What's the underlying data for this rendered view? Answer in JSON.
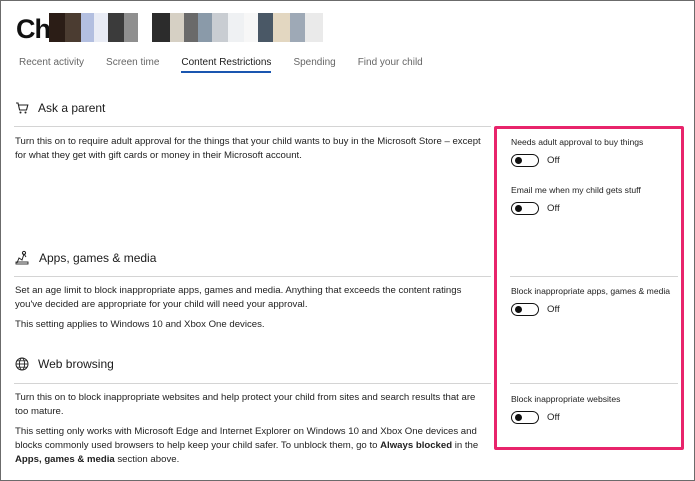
{
  "header": {
    "title": "Ch"
  },
  "tabs": [
    {
      "label": "Recent activity"
    },
    {
      "label": "Screen time"
    },
    {
      "label": "Content Restrictions"
    },
    {
      "label": "Spending"
    },
    {
      "label": "Find your child"
    }
  ],
  "ask_parent": {
    "title": "Ask a parent",
    "description": "Turn this on to require adult approval for the things that your child wants to buy in the Microsoft Store – except for what they get with gift cards or money in their Microsoft account.",
    "settings": [
      {
        "label": "Needs adult approval to buy things",
        "state": "Off"
      },
      {
        "label": "Email me when my child gets stuff",
        "state": "Off"
      }
    ]
  },
  "apps": {
    "title": "Apps, games & media",
    "description1": "Set an age limit to block inappropriate apps, games and media. Anything that exceeds the content ratings you've decided are appropriate for your child will need your approval.",
    "description2": "This setting applies to Windows 10 and Xbox One devices.",
    "settings": [
      {
        "label": "Block inappropriate apps, games & media",
        "state": "Off"
      }
    ]
  },
  "web": {
    "title": "Web browsing",
    "description1": "Turn this on to block inappropriate websites and help protect your child from sites and search results that are too mature.",
    "description2_prefix": "This setting only works with Microsoft Edge and Internet Explorer on Windows 10 and Xbox One devices and blocks commonly used browsers to help keep your child safer. To unblock them, go to ",
    "description2_bold1": "Always blocked",
    "description2_mid": " in the ",
    "description2_bold2": "Apps, games & media",
    "description2_suffix": " section above.",
    "settings": [
      {
        "label": "Block inappropriate websites",
        "state": "Off"
      }
    ]
  },
  "colors": {
    "accent": "#1a56b0",
    "highlight": "#e8246b"
  },
  "icons": [
    "cart-icon",
    "apps-media-icon",
    "globe-icon"
  ]
}
